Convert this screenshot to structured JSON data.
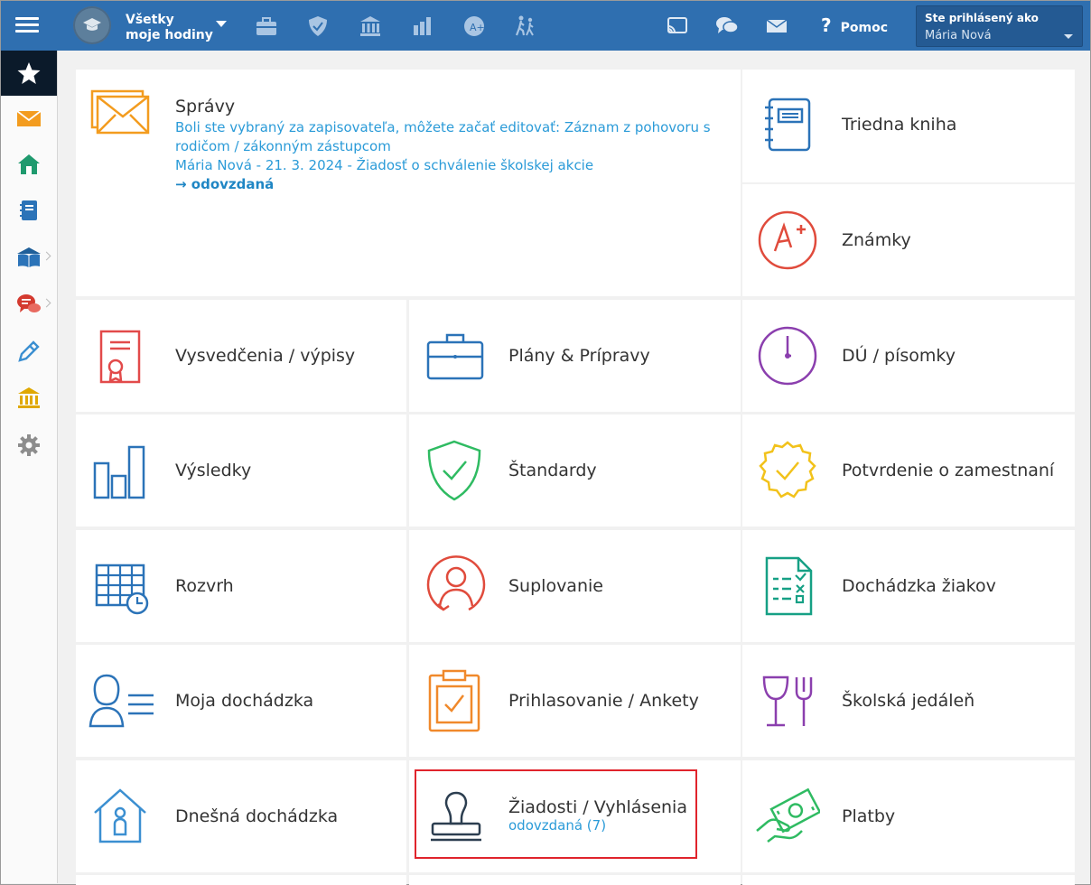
{
  "topbar": {
    "class_line1": "Všetky",
    "class_line2": "moje hodiny",
    "help_label": "Pomoc",
    "user_caption": "Ste prihlásený ako",
    "user_name": "Mária Nová",
    "color": "#2f6fb0"
  },
  "news": {
    "title": "Správy",
    "line1": "Boli ste vybraný za zapisovateľa, môžete začať editovať: Záznam z pohovoru s rodičom / zákonným zástupcom",
    "line2": "Mária Nová - 21. 3. 2024 - Žiadosť o schválenie školskej akcie",
    "line3": "→ odovzdaná"
  },
  "tiles": {
    "triedna_kniha": "Triedna kniha",
    "znamky": "Známky",
    "vysvedcenia": "Vysvedčenia / výpisy",
    "plany": "Plány & Prípravy",
    "du": "DÚ / písomky",
    "vysledky": "Výsledky",
    "standardy": "Štandardy",
    "potvrdenie": "Potvrdenie o zamestnaní",
    "rozvrh": "Rozvrh",
    "suplovanie": "Suplovanie",
    "dochadzka_ziakov": "Dochádzka žiakov",
    "moja_dochadzka": "Moja dochádzka",
    "prihlasovanie": "Prihlasovanie / Ankety",
    "jedalen": "Školská jedáleň",
    "dnesna": "Dnešná dochádzka",
    "ziadosti": "Žiadosti / Vyhlásenia",
    "ziadosti_sub": "odovzdaná (7)",
    "platby": "Platby"
  }
}
